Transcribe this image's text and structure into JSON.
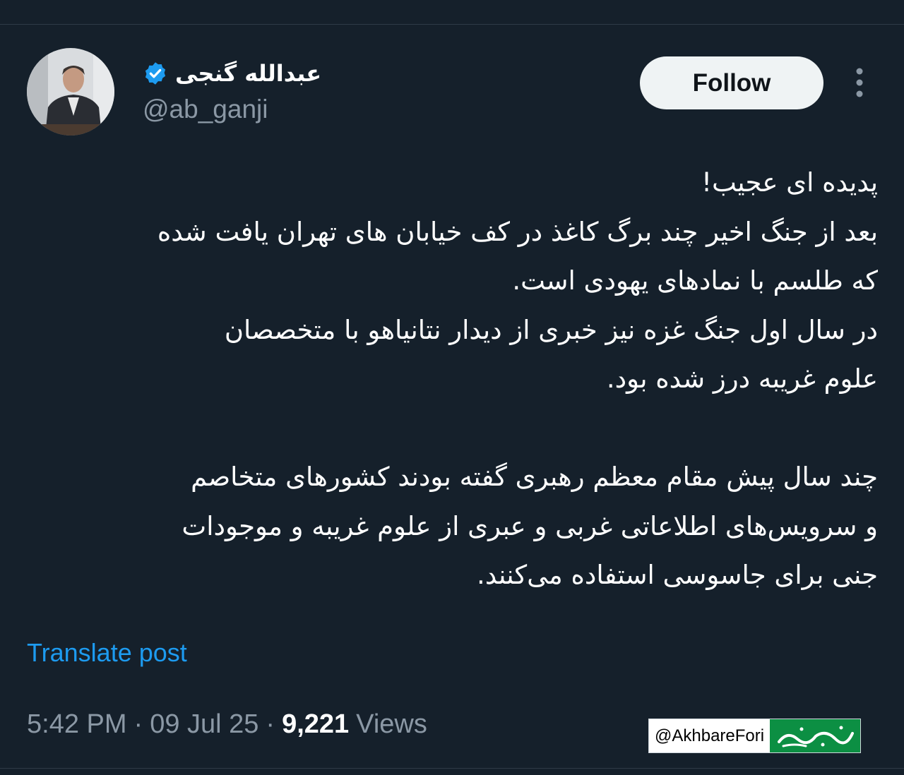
{
  "author": {
    "display_name": "عبدالله گنجی",
    "handle": "@ab_ganji",
    "verified": true
  },
  "actions": {
    "follow_label": "Follow",
    "more_icon": "more-vertical-icon"
  },
  "tweet": {
    "lines": [
      "پدیده ای عجیب!",
      "بعد از جنگ اخیر چند برگ کاغذ در کف خیابان های تهران یافت شده",
      "که طلسم با نمادهای یهودی است.",
      "در سال اول جنگ غزه نیز خبری از دیدار نتانیاهو با متخصصان",
      "علوم غریبه درز شده بود.",
      "",
      "چند سال پیش مقام معظم رهبری گفته بودند کشورهای متخاصم",
      "و سرویس‌های اطلاعاتی غربی و عبری از علوم غریبه و موجودات",
      "جنی برای جاسوسی استفاده می‌کنند."
    ],
    "translate_label": "Translate post"
  },
  "meta": {
    "time": "5:42 PM",
    "date": "09 Jul 25",
    "views_count": "9,221",
    "views_label": "Views",
    "separator": "·"
  },
  "watermark": {
    "handle": "@AkhbareFori",
    "logo_text": "خبرفوری",
    "logo_color": "#0c8f43"
  },
  "colors": {
    "background": "#15202b",
    "secondary_text": "#8b98a5",
    "link": "#1d9bf0",
    "verified_badge": "#1d9bf0"
  }
}
